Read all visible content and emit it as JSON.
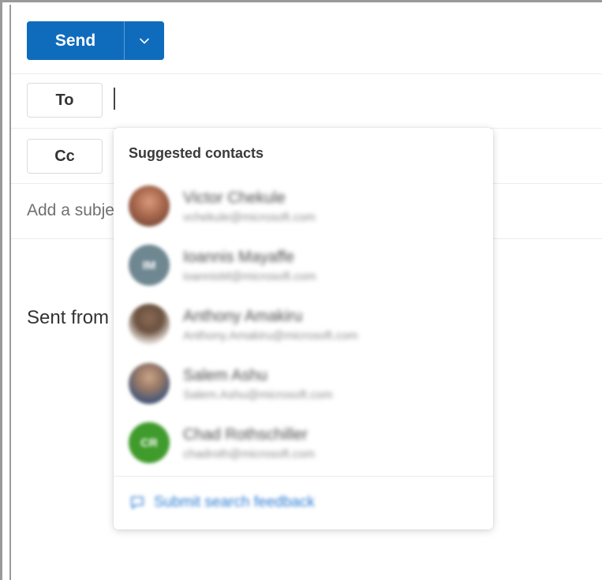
{
  "toolbar": {
    "send_label": "Send",
    "send_options_icon": "chevron-down-icon",
    "accent_color": "#0f6cbd"
  },
  "recipients": {
    "to_label": "To",
    "cc_label": "Cc",
    "to_value": ""
  },
  "subject": {
    "placeholder": "Add a subje"
  },
  "body": {
    "signature": "Sent from"
  },
  "suggestions": {
    "title": "Suggested contacts",
    "contacts": [
      {
        "name": "Victor Chekule",
        "email": "vchekule@microsoft.com",
        "avatar_color": "#a8674d"
      },
      {
        "name": "Ioannis Mayaffe",
        "email": "ioannisM@microsoft.com",
        "avatar_color": "#6f8791",
        "initials": "IM"
      },
      {
        "name": "Anthony Amakiru",
        "email": "Anthony.Amakiru@microsoft.com",
        "avatar_color": "#6b5140"
      },
      {
        "name": "Salem Ashu",
        "email": "Salem.Ashu@microsoft.com",
        "avatar_color": "#4d5a78"
      },
      {
        "name": "Chad Rothschiller",
        "email": "chadroth@microsoft.com",
        "avatar_color": "#3f9b2b",
        "initials": "CR"
      }
    ],
    "feedback_icon": "feedback-icon",
    "feedback_label": "Submit search feedback"
  }
}
